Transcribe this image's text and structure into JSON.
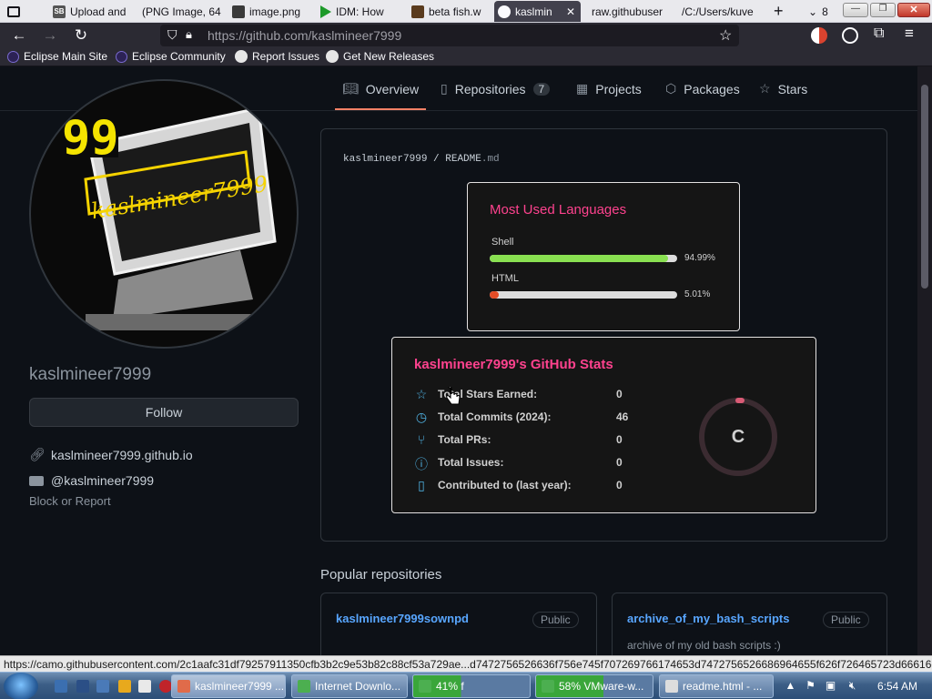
{
  "browser": {
    "tabs": [
      {
        "label": "",
        "icon": "tab-list-icon"
      },
      {
        "label": "Upload and",
        "icon": "sb-favicon-icon"
      },
      {
        "label": "(PNG Image, 64",
        "icon": "image-favicon-icon"
      },
      {
        "label": "image.png",
        "icon": "image-favicon-icon"
      },
      {
        "label": "IDM: How",
        "icon": "idm-favicon-icon"
      },
      {
        "label": "beta fish.w",
        "icon": "image-favicon-icon"
      },
      {
        "label": "kaslmin",
        "icon": "github-favicon-icon",
        "close": "✕"
      },
      {
        "label": "raw.githubuser",
        "icon": ""
      },
      {
        "label": "/C:/Users/kuve",
        "icon": ""
      }
    ],
    "new_tab": "+",
    "tab_count": "8",
    "url_prefix": "https://github.com/",
    "url_path": "kaslmineer7999",
    "bookmarks": [
      "Eclipse Main Site",
      "Eclipse Community",
      "Report Issues",
      "Get New Releases"
    ],
    "status_url": "https://camo.githubusercontent.com/2c1aafc31df79257911350cfb3b2c9e53b82c88cf53a729ae...d7472756526636f756e745f707269766174653d7472756526686964655f626f726465723d66616c7365"
  },
  "nav_tabs": [
    {
      "label": "Overview",
      "icon": "book-icon"
    },
    {
      "label": "Repositories",
      "icon": "repo-icon",
      "count": "7"
    },
    {
      "label": "Projects",
      "icon": "table-icon"
    },
    {
      "label": "Packages",
      "icon": "package-icon"
    },
    {
      "label": "Stars",
      "icon": "star-icon"
    }
  ],
  "profile": {
    "avatar_text": "kaslmineer7999",
    "avatar_badge": "99",
    "username": "kaslmineer7999",
    "follow_label": "Follow",
    "website": "kaslmineer7999.github.io",
    "youtube": "@kaslmineer7999",
    "block_label": "Block or Report"
  },
  "readme": {
    "user": "kaslmineer7999",
    "sep": "/",
    "file": "README",
    "ext": ".md"
  },
  "languages": {
    "title": "Most Used Languages",
    "items": [
      {
        "name": "Shell",
        "percent": 94.99,
        "label": "94.99%",
        "color": "#89e051"
      },
      {
        "name": "HTML",
        "percent": 5.01,
        "label": "5.01%",
        "color": "#e34c26"
      }
    ]
  },
  "stats": {
    "title": "kaslmineer7999's GitHub Stats",
    "rows": [
      {
        "label": "Total Stars Earned:",
        "value": "0",
        "icon": "star-outline-icon"
      },
      {
        "label": "Total Commits (2024):",
        "value": "46",
        "icon": "history-icon"
      },
      {
        "label": "Total PRs:",
        "value": "0",
        "icon": "pull-request-icon"
      },
      {
        "label": "Total Issues:",
        "value": "0",
        "icon": "issue-icon"
      },
      {
        "label": "Contributed to (last year):",
        "value": "0",
        "icon": "repo-icon"
      }
    ],
    "grade": "C"
  },
  "popular": {
    "heading": "Popular repositories",
    "repos": [
      {
        "name": "kaslmineer7999sownpd",
        "badge": "Public",
        "description": ""
      },
      {
        "name": "archive_of_my_bash_scripts",
        "badge": "Public",
        "description": "archive of my old bash scripts :)"
      }
    ]
  },
  "taskbar": {
    "buttons": [
      {
        "label": "kaslmineer7999 ...",
        "color": "#e06b4a"
      },
      {
        "label": "Internet Downlo...",
        "color": "#4caf50"
      },
      {
        "label": "41% f",
        "color": "#4caf50"
      },
      {
        "label": "58% VMware-w...",
        "color": "#4caf50"
      },
      {
        "label": "readme.html - ...",
        "color": "#dddddd"
      }
    ],
    "clock": "6:54 AM"
  }
}
